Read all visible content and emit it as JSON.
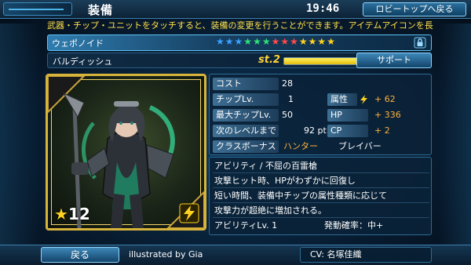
{
  "header": {
    "title": "装備",
    "clock": "19:46",
    "lobby_button": "ロビートップへ戻る"
  },
  "ticker": "武器・チップ・ユニットをタッチすると、装備の変更を行うことができます。アイテムアイコンを長",
  "weapon": {
    "type": "ウェポノイド",
    "stars_filled": 10,
    "stars_total": 13,
    "name": "バルディッシュ",
    "stage_label": "st.2",
    "stage_progress": 0.78,
    "support_button": "サポート"
  },
  "card": {
    "rarity_star": "★",
    "rarity": "12",
    "element_icon": "lightning-icon"
  },
  "stats": {
    "cost_label": "コスト",
    "cost": "28",
    "chip_lv_label": "チップLv.",
    "chip_lv": "1",
    "max_chip_lv_label": "最大チップLv.",
    "max_chip_lv": "50",
    "next_level_label": "次のレベルまで",
    "next_level": "92 pt",
    "class_bonus_label": "クラスボーナス",
    "class_bonus_hunter": "ハンター",
    "class_bonus_braver": "ブレイバー",
    "element_label": "属性",
    "element_value": "+ 62",
    "hp_label": "HP",
    "hp_value": "+ 336",
    "cp_label": "CP",
    "cp_value": "+ 2"
  },
  "ability": {
    "title": "アビリティ / 不屈の百雷槍",
    "line1": "攻撃ヒット時、HPがわずかに回復し",
    "line2": "短い時間、装備中チップの属性種類に応じて",
    "line3": "攻撃力が超絶に増加される。",
    "level": "アビリティLv. 1",
    "trigger": "発動確率：中+"
  },
  "footer": {
    "back_button": "戻る",
    "illustrated_by": "illustrated by  Gia",
    "cv": "CV: 名塚佳織"
  },
  "colors": {
    "accent": "#5ec3f5",
    "gold": "#d9b43a",
    "orange": "#ffb13b"
  }
}
